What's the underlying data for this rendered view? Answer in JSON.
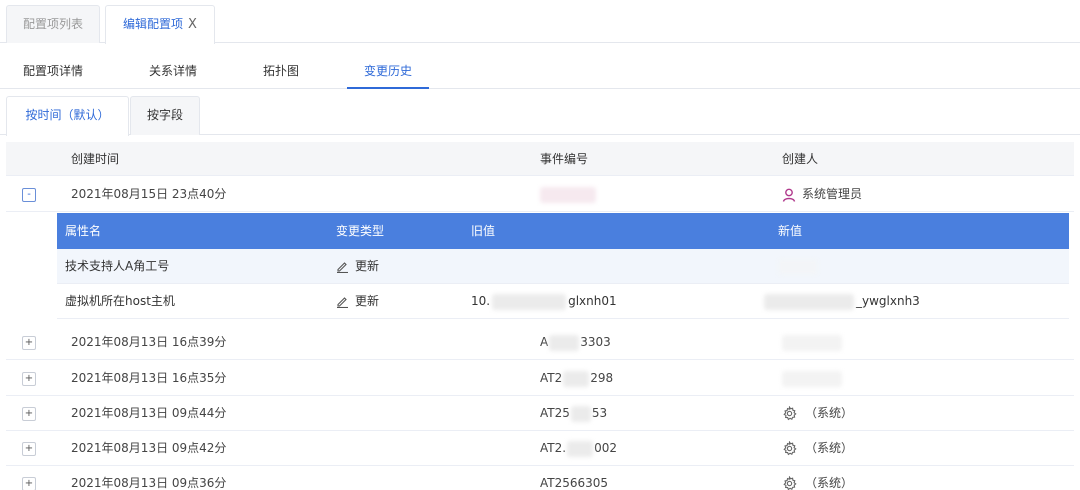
{
  "top_tabs": {
    "list_label": "配置项列表",
    "edit_label": "编辑配置项",
    "close_glyph": "X"
  },
  "sub_nav": [
    "配置项详情",
    "关系详情",
    "拓扑图",
    "变更历史"
  ],
  "mode_tabs": [
    "按时间（默认）",
    "按字段"
  ],
  "table": {
    "headers": {
      "time": "创建时间",
      "event": "事件编号",
      "creator": "创建人"
    },
    "rows": [
      {
        "toggle": "-",
        "time": "2021年08月15日 23点40分",
        "event": "",
        "creator": "系统管理员",
        "creator_icon": "user-icon"
      },
      {
        "toggle": "+",
        "time": "2021年08月13日 16点39分",
        "event_prefix": "A",
        "event_suffix": "3303",
        "creator": ""
      },
      {
        "toggle": "+",
        "time": "2021年08月13日 16点35分",
        "event_prefix": "AT2",
        "event_suffix": "298",
        "creator": ""
      },
      {
        "toggle": "+",
        "time": "2021年08月13日 09点44分",
        "event_prefix": "AT25",
        "event_suffix": "53",
        "creator": "（系统）",
        "creator_icon": "gear-icon"
      },
      {
        "toggle": "+",
        "time": "2021年08月13日 09点42分",
        "event_prefix": "AT2.",
        "event_suffix": "002",
        "creator": "（系统）",
        "creator_icon": "gear-icon"
      },
      {
        "toggle": "+",
        "time": "2021年08月13日 09点36分",
        "event_prefix": "AT2566305",
        "event_suffix": "",
        "creator": "（系统）",
        "creator_icon": "gear-icon"
      }
    ]
  },
  "detail": {
    "headers": {
      "attr": "属性名",
      "type": "变更类型",
      "old": "旧值",
      "new": "新值"
    },
    "rows": [
      {
        "attr": "技术支持人A角工号",
        "type": "更新",
        "old": "",
        "new": ""
      },
      {
        "attr": "虚拟机所在host主机",
        "type": "更新",
        "old_prefix": "10.",
        "old_suffix": "glxnh01",
        "new_prefix": "",
        "new_suffix": "_ywglxnh3"
      }
    ]
  },
  "colors": {
    "accent": "#2f6ad8",
    "detail_header": "#4a7fde",
    "user_icon": "#b0398c"
  }
}
